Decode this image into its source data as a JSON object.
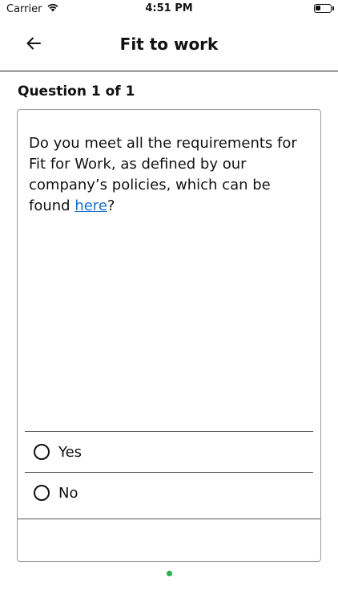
{
  "status_bar": {
    "carrier": "Carrier",
    "time": "4:51 PM",
    "battery_icon": "battery-low-icon",
    "wifi_icon": "wifi-icon"
  },
  "header": {
    "title": "Fit to work",
    "back_icon": "arrow-left-icon"
  },
  "question": {
    "counter": "Question 1 of 1",
    "text_before_link": "Do you meet all the requirements for Fit for Work, as defined by our company’s policies, which can be found ",
    "link_text": "here",
    "text_after_link": "?",
    "options": [
      {
        "label": "Yes",
        "selected": false
      },
      {
        "label": "No",
        "selected": false
      }
    ]
  },
  "pager": {
    "current": 1,
    "total": 1,
    "dot_color": "#2bb04e"
  },
  "colors": {
    "link": "#1a6fd1",
    "accent": "#2bb04e"
  }
}
